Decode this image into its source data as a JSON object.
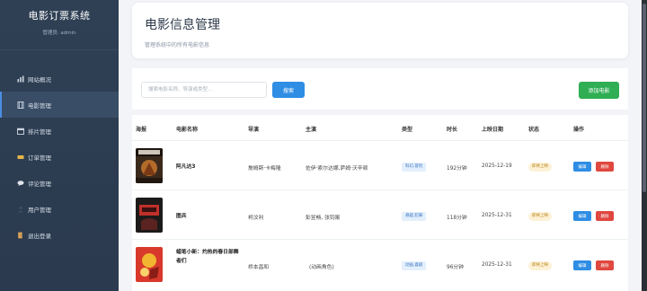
{
  "sidebar": {
    "title": "电影订票系统",
    "user": "管理员: admin",
    "items": [
      {
        "label": "网站概况",
        "icon": "bar-chart-icon"
      },
      {
        "label": "电影管理",
        "icon": "film-icon"
      },
      {
        "label": "排片管理",
        "icon": "calendar-icon"
      },
      {
        "label": "订单管理",
        "icon": "ticket-icon"
      },
      {
        "label": "评论管理",
        "icon": "comment-icon"
      },
      {
        "label": "用户管理",
        "icon": "user-icon"
      },
      {
        "label": "退出登录",
        "icon": "logout-icon"
      }
    ],
    "active_index": 1
  },
  "header": {
    "title": "电影信息管理",
    "subtitle": "管理系统中的所有电影信息"
  },
  "toolbar": {
    "search_placeholder": "搜索电影名称、导演或类型...",
    "search_label": "搜索",
    "add_label": "添加电影"
  },
  "table": {
    "columns": [
      "海报",
      "电影名称",
      "导演",
      "主演",
      "类型",
      "时长",
      "上映日期",
      "状态",
      "操作"
    ],
    "rows": [
      {
        "name": "阿凡达3",
        "director": "詹姆斯·卡梅隆",
        "cast": "佐伊·索尔达娜,萨姆·沃辛顿",
        "genre": "科幻,冒险",
        "duration": "192分钟",
        "date": "2025-12-19",
        "status": "即将上映",
        "edit": "编辑",
        "delete": "删除",
        "poster_colors": [
          "#3b2a1c",
          "#b36b2a"
        ]
      },
      {
        "name": "图兵",
        "director": "柯汶利",
        "cast": "彭昱畅, 张钧甯",
        "genre": "悬疑,犯罪",
        "duration": "118分钟",
        "date": "2025-12-31",
        "status": "即将上映",
        "edit": "编辑",
        "delete": "删除",
        "poster_colors": [
          "#1d1a1a",
          "#c0302a"
        ]
      },
      {
        "name": "蜡笔小新：灼热的春日部舞者们",
        "director": "桥本昌和",
        "cast": "(动画角色)",
        "genre": "动画,喜剧",
        "duration": "96分钟",
        "date": "2025-12-31",
        "status": "即将上映",
        "edit": "编辑",
        "delete": "删除",
        "poster_colors": [
          "#d8392b",
          "#f2b530"
        ]
      }
    ]
  },
  "colors": {
    "sidebar_bg": "#2f4055",
    "primary": "#2f8de4",
    "success": "#2fae54",
    "danger": "#e0473f"
  }
}
